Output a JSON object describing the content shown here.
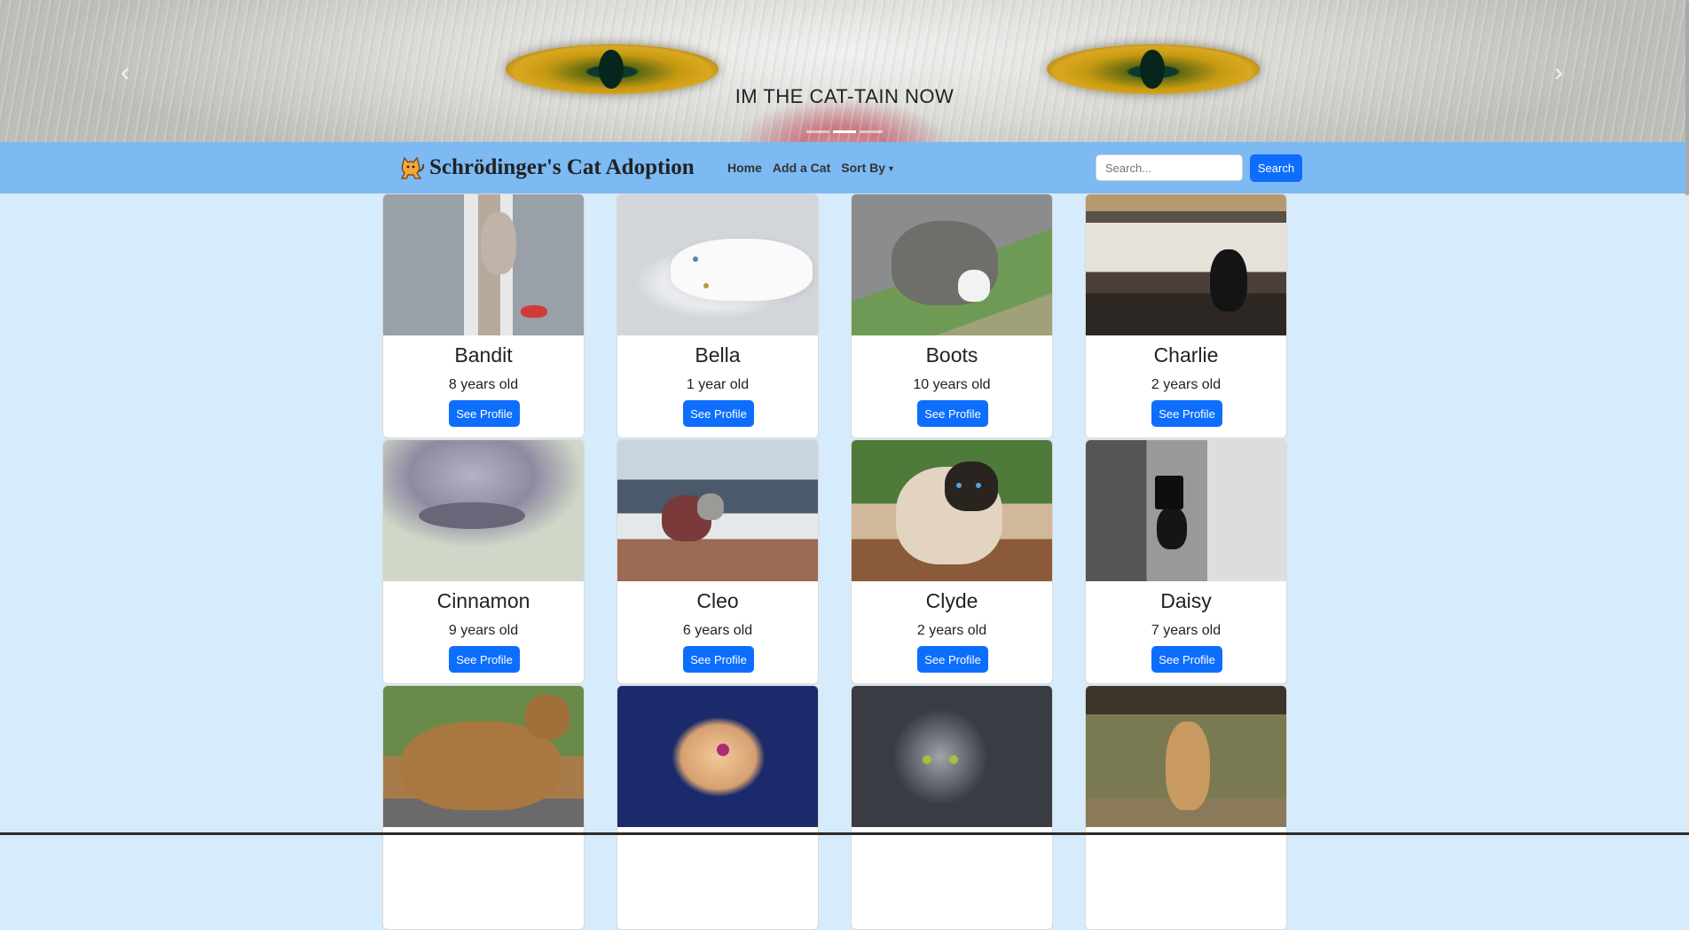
{
  "carousel": {
    "caption": "IM THE CAT-TAIN NOW",
    "indicators": 3,
    "active_indicator": 1,
    "prev_icon": "chevron-left-icon",
    "next_icon": "chevron-right-icon"
  },
  "navbar": {
    "brand": "Schrödinger's Cat Adoption",
    "brand_icon": "cat-icon",
    "links": [
      {
        "label": "Home"
      },
      {
        "label": "Add a Cat"
      },
      {
        "label": "Sort By"
      }
    ],
    "search": {
      "placeholder": "Search...",
      "button_label": "Search"
    },
    "colors": {
      "navbar": "#7db9f3",
      "primary": "#0d6efd",
      "page_bg": "#d6ebfb"
    }
  },
  "cats": [
    {
      "name": "Bandit",
      "age": "8 years old",
      "button": "See Profile"
    },
    {
      "name": "Bella",
      "age": "1 year old",
      "button": "See Profile"
    },
    {
      "name": "Boots",
      "age": "10 years old",
      "button": "See Profile"
    },
    {
      "name": "Charlie",
      "age": "2 years old",
      "button": "See Profile"
    },
    {
      "name": "Cinnamon",
      "age": "9 years old",
      "button": "See Profile"
    },
    {
      "name": "Cleo",
      "age": "6 years old",
      "button": "See Profile"
    },
    {
      "name": "Clyde",
      "age": "2 years old",
      "button": "See Profile"
    },
    {
      "name": "Daisy",
      "age": "7 years old",
      "button": "See Profile"
    },
    {
      "name": "",
      "age": "",
      "button": ""
    },
    {
      "name": "",
      "age": "",
      "button": ""
    },
    {
      "name": "",
      "age": "",
      "button": ""
    },
    {
      "name": "",
      "age": "",
      "button": ""
    }
  ]
}
